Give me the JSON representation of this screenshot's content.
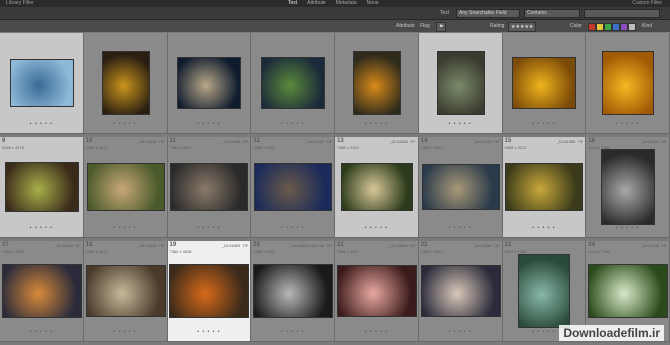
{
  "window": {
    "title": "Library Filter",
    "right_label": "Custom Filter"
  },
  "tabs": [
    {
      "label": "Text",
      "active": true
    },
    {
      "label": "Attribute",
      "active": false
    },
    {
      "label": "Metadata",
      "active": false
    },
    {
      "label": "None",
      "active": false
    }
  ],
  "filter": {
    "text_label": "Text",
    "field_value": "Any Searchable Field",
    "op_value": "Contains"
  },
  "attributes": {
    "label": "Attribute",
    "flag_label": "Flag",
    "rating_label": "Rating",
    "color_label": "Color",
    "kind_label": "Kind",
    "colors": [
      "#c0392b",
      "#e2c63b",
      "#3fa64a",
      "#3d6fc4",
      "#8a4fbf",
      "#bdbdbd"
    ]
  },
  "cells": [
    {
      "num": "",
      "dims": "",
      "file": "",
      "badge": "",
      "thumb": {
        "w": 62,
        "h": 46,
        "c1": "#8fb9d8",
        "c2": "#3a6a96"
      },
      "selected": true,
      "active": false
    },
    {
      "num": "",
      "dims": "",
      "file": "",
      "badge": "",
      "thumb": {
        "w": 46,
        "h": 62,
        "c1": "#2a1e12",
        "c2": "#c9951c"
      },
      "selected": false,
      "active": false
    },
    {
      "num": "",
      "dims": "",
      "file": "",
      "badge": "",
      "thumb": {
        "w": 62,
        "h": 50,
        "c1": "#0f1c2e",
        "c2": "#b8a788"
      },
      "selected": false,
      "active": false
    },
    {
      "num": "",
      "dims": "",
      "file": "",
      "badge": "",
      "thumb": {
        "w": 62,
        "h": 50,
        "c1": "#1b2a3a",
        "c2": "#5a8a3a"
      },
      "selected": false,
      "active": false
    },
    {
      "num": "",
      "dims": "",
      "file": "",
      "badge": "",
      "thumb": {
        "w": 46,
        "h": 62,
        "c1": "#2d2a1c",
        "c2": "#d98a1a"
      },
      "selected": false,
      "active": false
    },
    {
      "num": "",
      "dims": "",
      "file": "",
      "badge": "",
      "thumb": {
        "w": 46,
        "h": 62,
        "c1": "#3a3a2e",
        "c2": "#7a8a6a"
      },
      "selected": true,
      "active": false
    },
    {
      "num": "",
      "dims": "",
      "file": "",
      "badge": "",
      "thumb": {
        "w": 62,
        "h": 50,
        "c1": "#7a4a08",
        "c2": "#f0b41c"
      },
      "selected": false,
      "active": false
    },
    {
      "num": "",
      "dims": "",
      "file": "",
      "badge": "",
      "thumb": {
        "w": 50,
        "h": 62,
        "c1": "#a05a05",
        "c2": "#f5b822"
      },
      "selected": false,
      "active": false
    },
    {
      "num": "9",
      "dims": "3348 x 4176",
      "file": "",
      "badge": "",
      "thumb": {
        "w": 72,
        "h": 48,
        "c1": "#3a2a1a",
        "c2": "#a8b04a"
      },
      "selected": true,
      "active": false
    },
    {
      "num": "10",
      "dims": "7360 x 4912",
      "file": "_DL04448",
      "badge": "TIF",
      "thumb": {
        "w": 76,
        "h": 46,
        "c1": "#4a5a2a",
        "c2": "#c8a878"
      },
      "selected": false,
      "active": false
    },
    {
      "num": "11",
      "dims": "7360 x 4912",
      "file": "_DL04448",
      "badge": "TIF",
      "thumb": {
        "w": 76,
        "h": 46,
        "c1": "#2a2a2a",
        "c2": "#8a7a6a"
      },
      "selected": false,
      "active": false
    },
    {
      "num": "12",
      "dims": "7360 x 4912",
      "file": "_DL04457",
      "badge": "TIF",
      "thumb": {
        "w": 76,
        "h": 46,
        "c1": "#1a2a5a",
        "c2": "#6a5a4a"
      },
      "selected": false,
      "active": false
    },
    {
      "num": "13",
      "dims": "7360 x 4912",
      "file": "_DL04468",
      "badge": "TIF",
      "thumb": {
        "w": 70,
        "h": 46,
        "c1": "#2a3a1a",
        "c2": "#d8c898"
      },
      "selected": true,
      "active": false
    },
    {
      "num": "14",
      "dims": "7360 x 4912",
      "file": "_DL04474",
      "badge": "TIF",
      "thumb": {
        "w": 76,
        "h": 44,
        "c1": "#2a3a4a",
        "c2": "#a89878"
      },
      "selected": false,
      "active": false
    },
    {
      "num": "15",
      "dims": "4908 x 3272",
      "file": "_DL04485",
      "badge": "TIF",
      "thumb": {
        "w": 76,
        "h": 46,
        "c1": "#3a3a1a",
        "c2": "#c8a83a"
      },
      "selected": true,
      "active": false
    },
    {
      "num": "16",
      "dims": "4912 x 7360",
      "file": "_DL04491",
      "badge": "TIF",
      "thumb": {
        "w": 52,
        "h": 74,
        "c1": "#2a2a2a",
        "c2": "#a8a8a8"
      },
      "selected": false,
      "active": false
    },
    {
      "num": "17",
      "dims": "7360 x 4912",
      "file": "_DL04448",
      "badge": "TIF",
      "thumb": {
        "w": 78,
        "h": 52,
        "c1": "#2a2a3a",
        "c2": "#d88a3a"
      },
      "selected": false,
      "active": false
    },
    {
      "num": "18",
      "dims": "7360 x 4912",
      "file": "_DL04449",
      "badge": "TIF",
      "thumb": {
        "w": 78,
        "h": 50,
        "c1": "#4a3a2a",
        "c2": "#c8b89a"
      },
      "selected": false,
      "active": false
    },
    {
      "num": "19",
      "dims": "7360 x 4928",
      "file": "_DL04829",
      "badge": "TIF",
      "thumb": {
        "w": 78,
        "h": 52,
        "c1": "#3a2a1a",
        "c2": "#d86a1a"
      },
      "selected": false,
      "active": true
    },
    {
      "num": "20",
      "dims": "7360 x 4912",
      "file": "_DL04669 Edit Edit",
      "badge": "TIF",
      "thumb": {
        "w": 78,
        "h": 52,
        "c1": "#1a1a1a",
        "c2": "#b8b8b8"
      },
      "selected": false,
      "active": false
    },
    {
      "num": "21",
      "dims": "7360 x 4912",
      "file": "_DL04680",
      "badge": "TIF",
      "thumb": {
        "w": 78,
        "h": 50,
        "c1": "#3a1a1a",
        "c2": "#e8a8a0"
      },
      "selected": false,
      "active": false
    },
    {
      "num": "22",
      "dims": "7360 x 4912",
      "file": "_DL04696",
      "badge": "TIF",
      "thumb": {
        "w": 78,
        "h": 50,
        "c1": "#2a2a3a",
        "c2": "#d8c8b8"
      },
      "selected": false,
      "active": false
    },
    {
      "num": "23",
      "dims": "4912 x 7360",
      "file": "",
      "badge": "",
      "thumb": {
        "w": 50,
        "h": 72,
        "c1": "#2a4a3a",
        "c2": "#88b8a8"
      },
      "selected": false,
      "active": false
    },
    {
      "num": "24",
      "dims": "4912 x 7360",
      "file": "_DL04736",
      "badge": "TIF",
      "thumb": {
        "w": 78,
        "h": 52,
        "c1": "#2a4a1a",
        "c2": "#d8e8c8"
      },
      "selected": false,
      "active": false
    }
  ],
  "watermark": "Downloadefilm.ir"
}
